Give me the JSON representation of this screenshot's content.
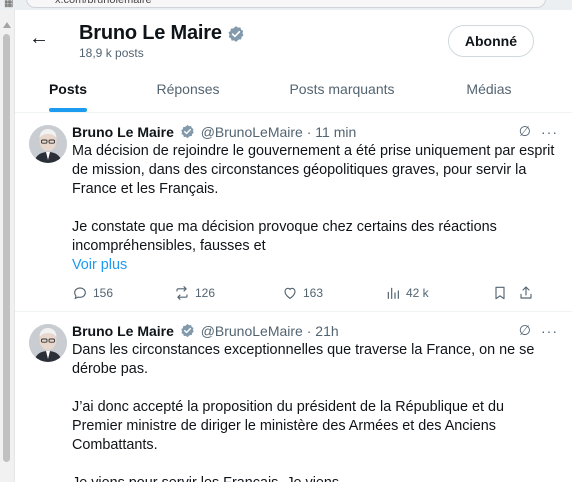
{
  "browser": {
    "url": "x.com/brunolemaire"
  },
  "profile": {
    "name": "Bruno Le Maire",
    "post_count": "18,9 k posts",
    "follow_label": "Abonné"
  },
  "tabs": [
    {
      "label": "Posts",
      "active": true
    },
    {
      "label": "Réponses",
      "active": false
    },
    {
      "label": "Posts marquants",
      "active": false
    },
    {
      "label": "Médias",
      "active": false
    }
  ],
  "posts": [
    {
      "author": "Bruno Le Maire",
      "handle": "@BrunoLeMaire · 11 min",
      "lines": [
        "Ma décision de rejoindre le gouvernement a été prise uniquement par esprit",
        "de mission, dans des circonstances géopolitiques graves, pour servir la",
        "France et les Français.",
        "",
        "Je constate que ma décision provoque chez certains des réactions",
        "incompréhensibles, fausses et"
      ],
      "show_more": "Voir plus",
      "replies": "156",
      "reposts": "126",
      "likes": "163",
      "views": "42 k"
    },
    {
      "author": "Bruno Le Maire",
      "handle": "@BrunoLeMaire · 21h",
      "lines": [
        "Dans les circonstances exceptionnelles que traverse la France, on ne se",
        "dérobe pas.",
        "",
        "J’ai donc accepté la proposition du président de la République et du",
        "Premier ministre de diriger le ministère des Armées et des Anciens",
        "Combattants.",
        "",
        "Je viens pour servir les Français. Je viens"
      ]
    }
  ],
  "colors": {
    "accent": "#1d9bf0",
    "text": "#0f1419",
    "muted": "#536471"
  }
}
